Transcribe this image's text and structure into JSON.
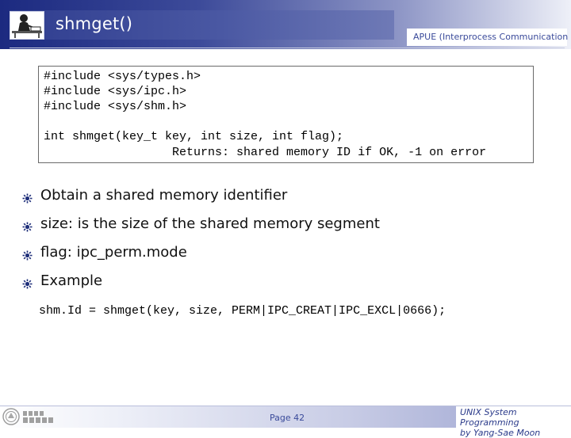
{
  "header": {
    "title": "shmget()",
    "course": "APUE (Interprocess Communication",
    "icon": "person-at-desk-icon"
  },
  "code_box": {
    "lines": [
      "#include <sys/types.h>",
      "#include <sys/ipc.h>",
      "#include <sys/shm.h>",
      "int shmget(key_t key, int size, int flag);",
      "                  Returns: shared memory ID if OK, -1 on error"
    ]
  },
  "bullets": [
    "Obtain a shared memory identifier",
    "size: is the size of the shared memory segment",
    "flag: ipc_perm.mode",
    "Example"
  ],
  "example_code": "shm.Id = shmget(key, size, PERM|IPC_CREAT|IPC_EXCL|0666);",
  "footer": {
    "page": "Page 42",
    "credit_line1": "UNIX System Programming",
    "credit_line2": "by Yang-Sae Moon",
    "logo_text": "university-seal-logo"
  },
  "colors": {
    "header_dark": "#1c2a80",
    "accent_text": "#3a4a9a",
    "bullet": "#1f2f7a"
  }
}
